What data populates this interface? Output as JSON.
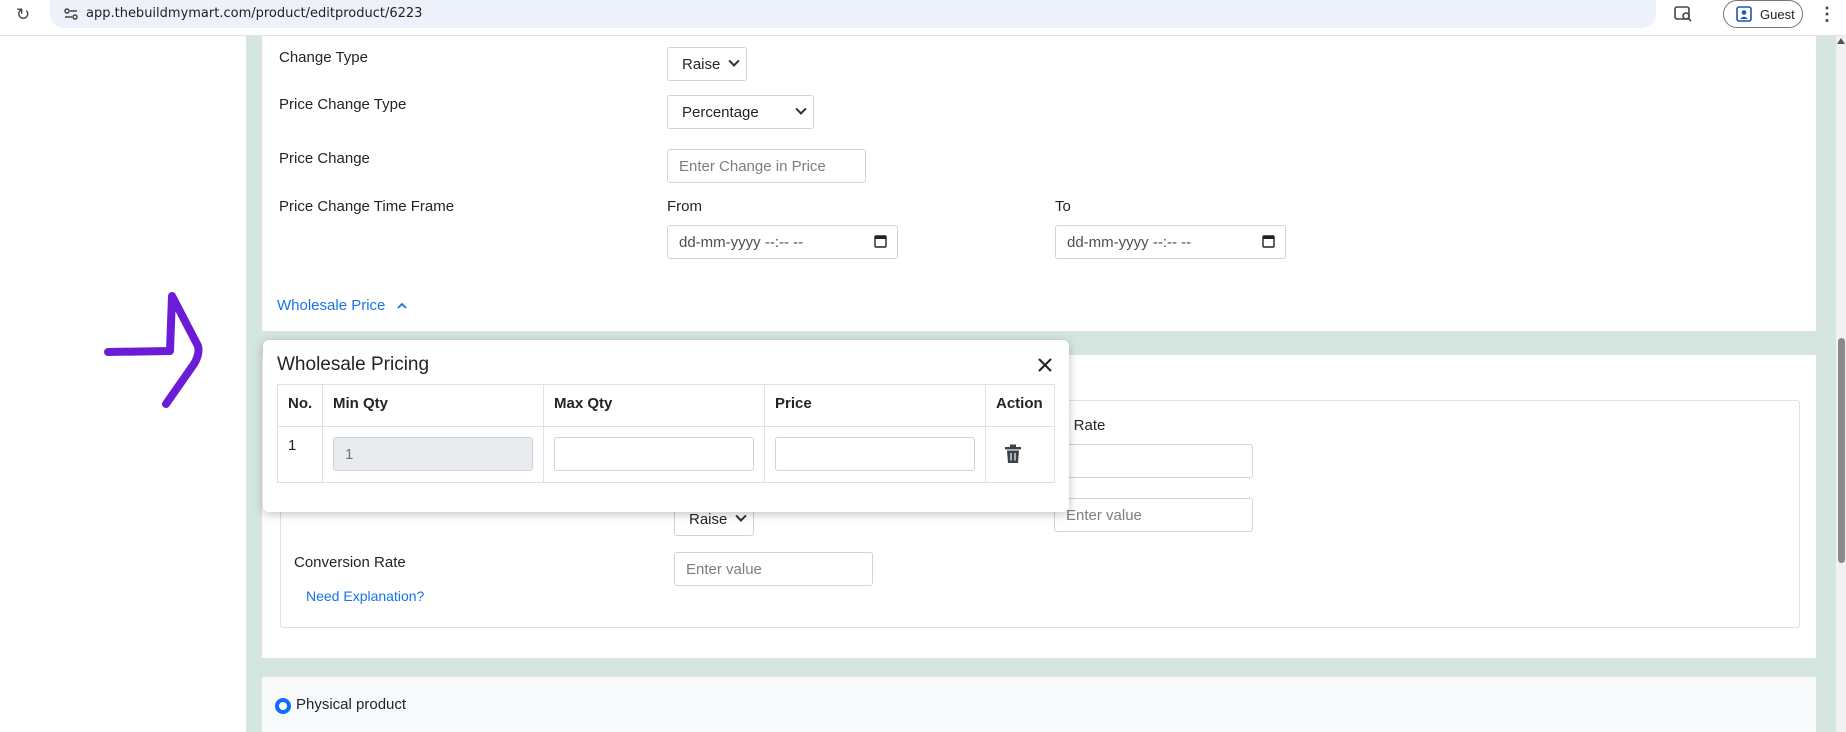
{
  "browser": {
    "url": "app.thebuildmymart.com/product/editproduct/6223",
    "guest_label": "Guest"
  },
  "price_form": {
    "change_type_label": "Change Type",
    "change_type_value": "Raise",
    "price_change_type_label": "Price Change Type",
    "price_change_type_value": "Percentage",
    "price_change_label": "Price Change",
    "price_change_placeholder": "Enter Change in Price",
    "time_frame_label": "Price Change Time Frame",
    "from_label": "From",
    "to_label": "To",
    "date_placeholder": "dd-mm-yyyy --:-- --",
    "wholesale_link": "Wholesale Price"
  },
  "tax_section": {
    "tax_rate_label": "x Rate",
    "raise_value": "Raise",
    "enter_value_placeholder": "Enter value",
    "conversion_rate_label": "Conversion Rate",
    "conversion_placeholder": "Enter value",
    "need_explanation": "Need Explanation?"
  },
  "modal": {
    "title": "Wholesale Pricing",
    "columns": [
      "No.",
      "Min Qty",
      "Max Qty",
      "Price",
      "Action"
    ],
    "rows": [
      {
        "no": "1",
        "min_qty": "1",
        "max_qty": "",
        "price": ""
      }
    ]
  },
  "product_type": {
    "physical_label": "Physical product"
  },
  "colors": {
    "accent_link": "#1a73e8",
    "radio": "#0d6efd",
    "page_bg": "#d5e6e1",
    "annotation": "#6a1cd6"
  },
  "icons": {
    "reload": "reload-icon",
    "site_info": "site-info-icon",
    "lens": "lens-icon",
    "profile": "profile-icon",
    "menu": "kebab-menu-icon",
    "calendar": "calendar-icon",
    "chevron_up": "chevron-up-icon",
    "close": "close-icon",
    "trash": "trash-icon"
  }
}
